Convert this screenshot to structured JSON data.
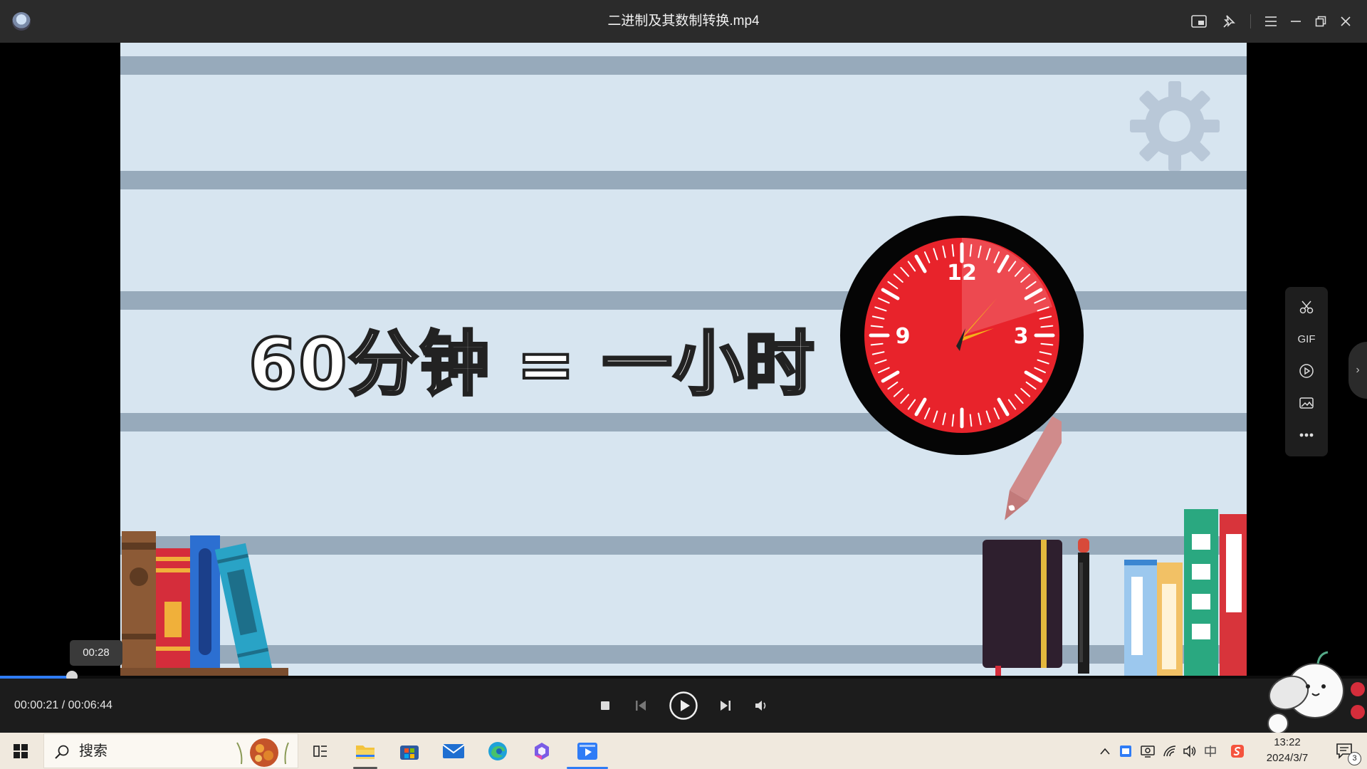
{
  "window": {
    "title": "二进制及其数制转换.mp4"
  },
  "video": {
    "caption": "60分钟 = 一小时",
    "clock_numbers": [
      "12",
      "3",
      "9"
    ]
  },
  "side_panel": {
    "gif_label": "GIF"
  },
  "player": {
    "hover_time": "00:28",
    "current_time": "00:00:21",
    "separator": "/",
    "total_time": "00:06:44",
    "progress_fraction": 0.0525
  },
  "taskbar": {
    "search_label": "搜索",
    "time": "13:22",
    "date": "2024/3/7",
    "notification_count": "3"
  },
  "colors": {
    "accent": "#2f7cf6",
    "clock_face": "#e8232b"
  }
}
